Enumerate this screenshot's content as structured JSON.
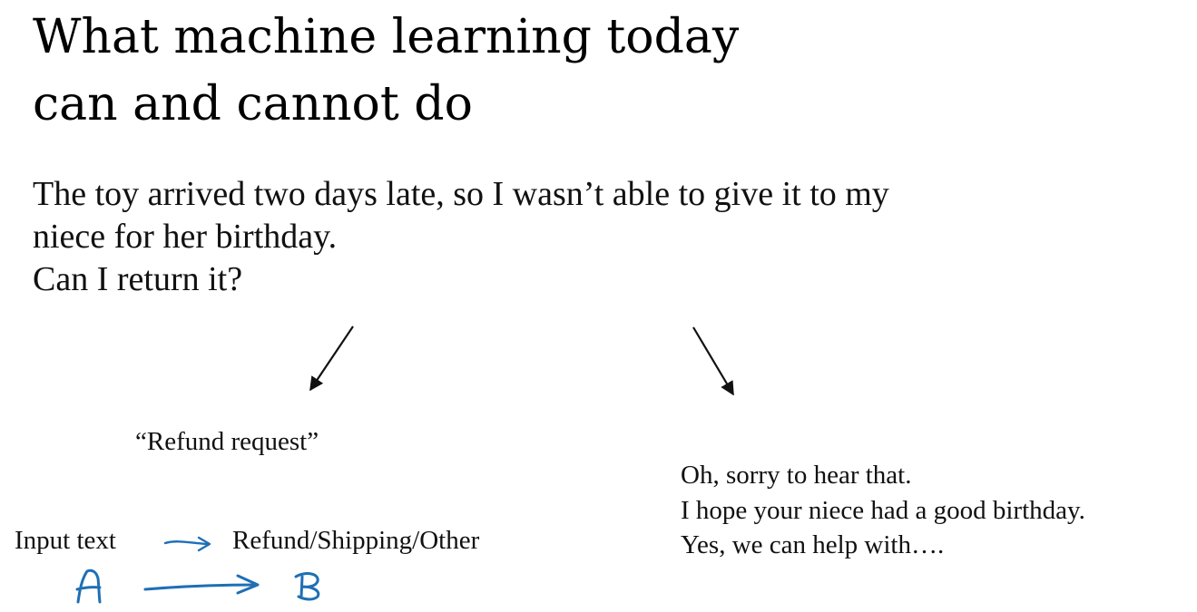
{
  "slide": {
    "title_lines": [
      "What machine learning today",
      "can and cannot do"
    ],
    "email_lines": [
      "The toy arrived two days late, so I wasn’t able to give it to my",
      "niece for her birthday.",
      "Can I return it?"
    ],
    "classification_label": "“Refund request”",
    "reply_lines": [
      "Oh, sorry to hear that.",
      "I hope your niece had a good birthday.",
      "Yes, we can help with…."
    ],
    "mapping": {
      "input_label": "Input text",
      "output_label": "Refund/Shipping/Other"
    },
    "annotation": {
      "input_letter": "A",
      "output_letter": "B",
      "ink_color": "#1f6fb5"
    }
  }
}
